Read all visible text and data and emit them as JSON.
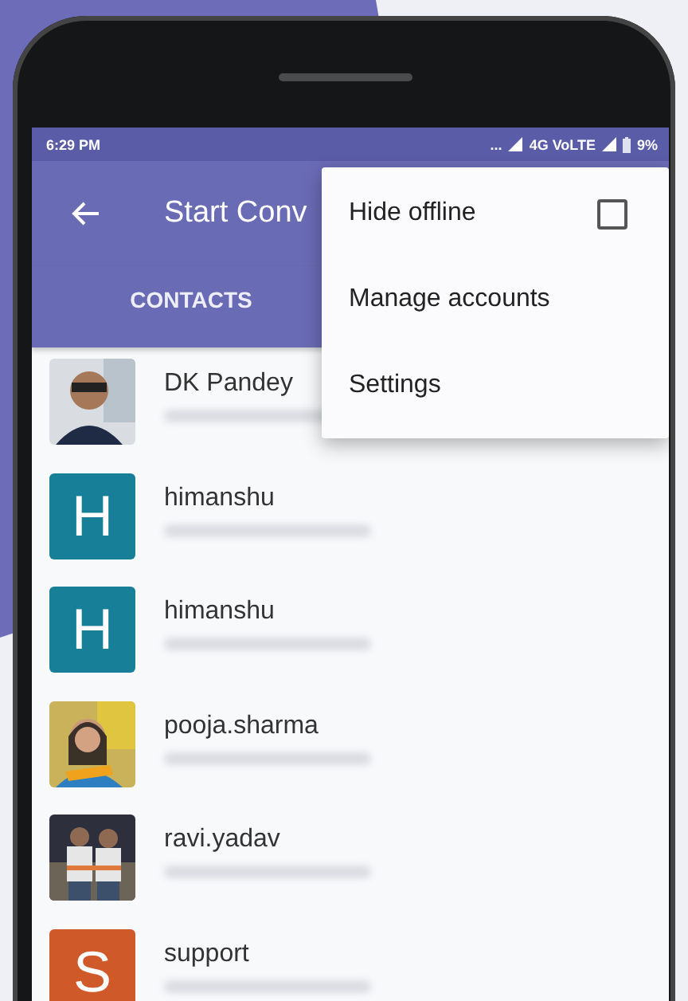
{
  "status_bar": {
    "time": "6:29 PM",
    "dots": "...",
    "network": "4G VoLTE",
    "battery": "9%"
  },
  "toolbar": {
    "title": "Start Conv"
  },
  "tabs": [
    {
      "label": "CONTACTS"
    }
  ],
  "menu": [
    {
      "label": "Hide offline",
      "kind": "checkbox",
      "checked": false
    },
    {
      "label": "Manage accounts",
      "kind": "item"
    },
    {
      "label": "Settings",
      "kind": "item"
    }
  ],
  "contacts": [
    {
      "name": "DK Pandey"
    },
    {
      "name": "himanshu",
      "avatar": {
        "kind": "letter",
        "letter": "H",
        "color": "#177f98"
      }
    },
    {
      "name": "himanshu",
      "avatar": {
        "kind": "letter",
        "letter": "H",
        "color": "#177f98"
      }
    },
    {
      "name": "pooja.sharma"
    },
    {
      "name": "ravi.yadav"
    },
    {
      "name": "support",
      "avatar": {
        "kind": "letter",
        "letter": "S",
        "color": "#d0592a"
      }
    }
  ]
}
